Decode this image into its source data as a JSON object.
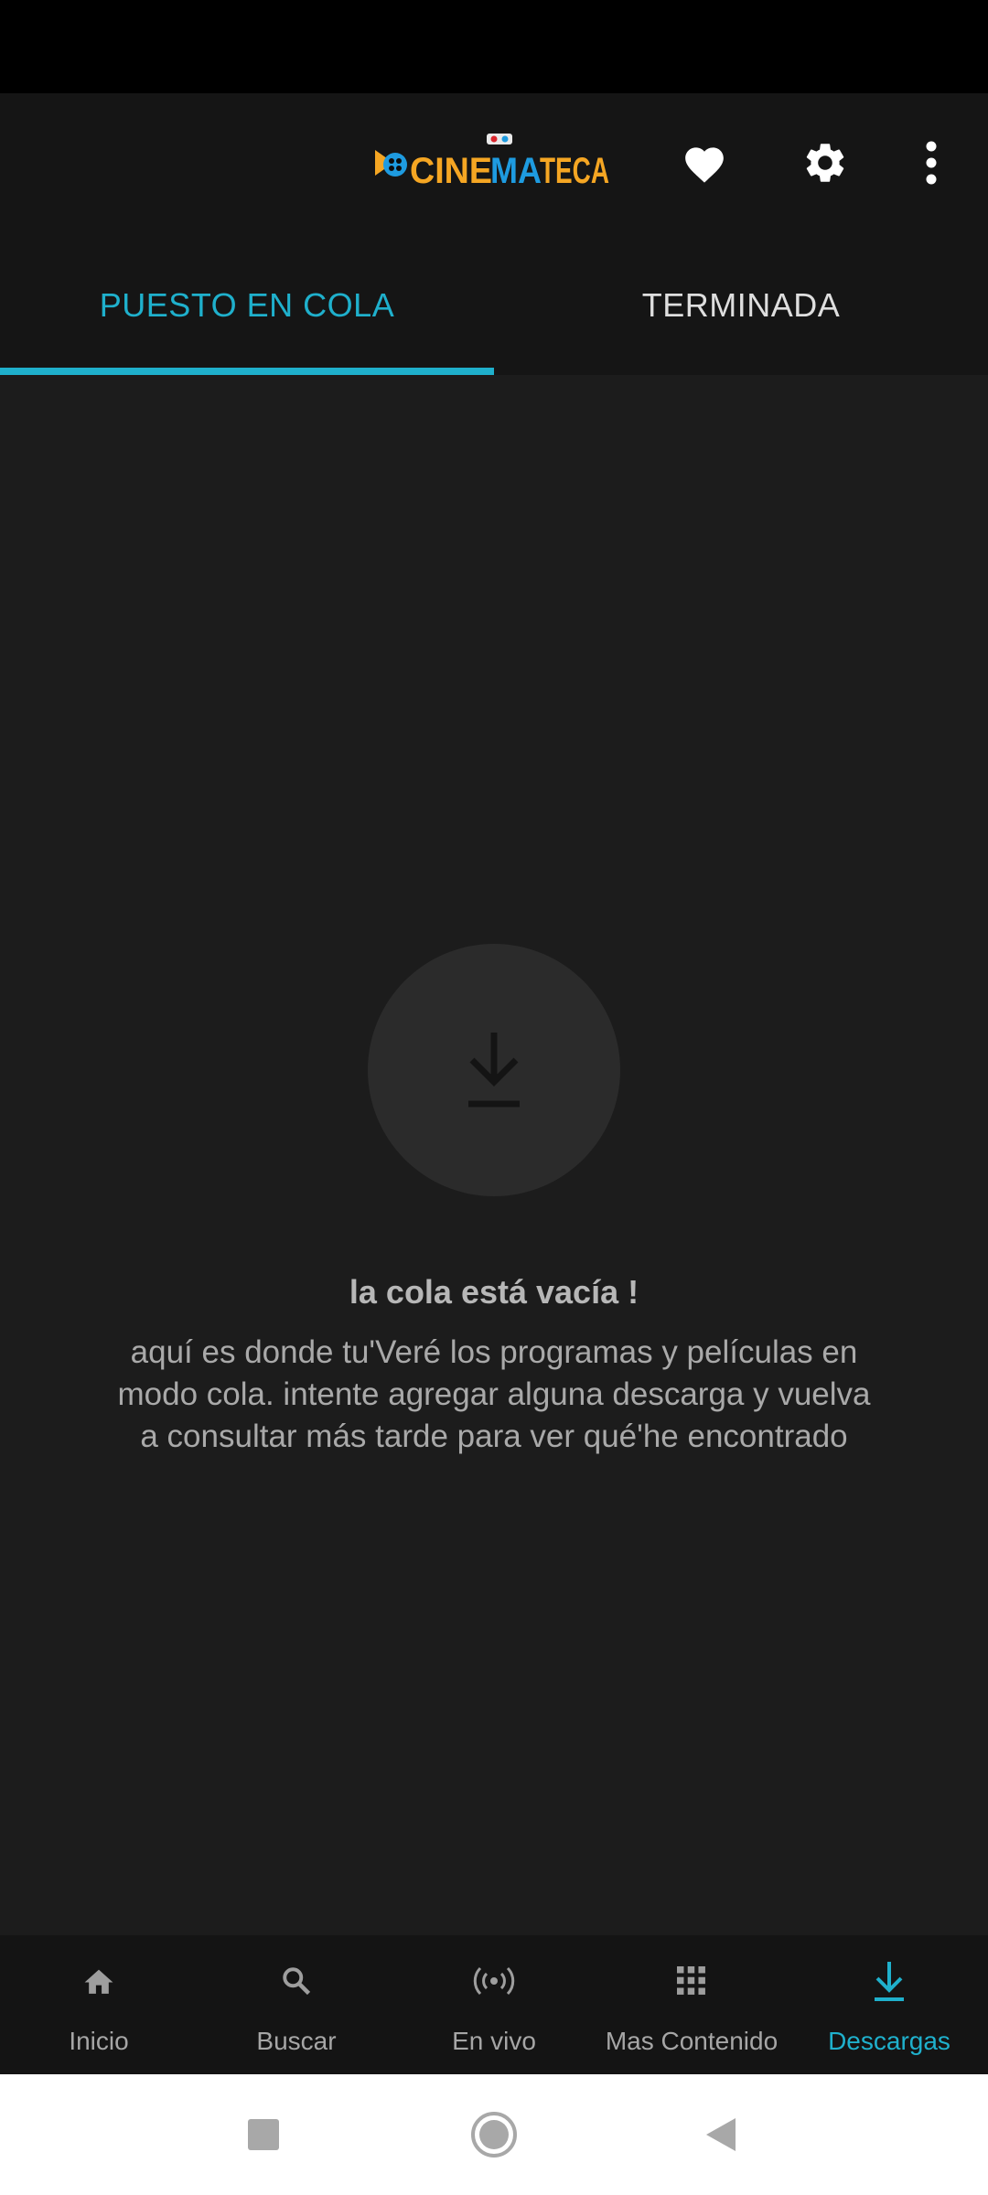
{
  "app": {
    "logo_text": "CINEMATECA",
    "brand_colors": {
      "orange": "#f5a623",
      "blue": "#1e9be0",
      "accent": "#1fb0cc"
    }
  },
  "header": {
    "icons": [
      "heart-icon",
      "gear-icon",
      "more-vert-icon"
    ]
  },
  "tabs": [
    {
      "label": "PUESTO EN COLA",
      "active": true
    },
    {
      "label": "TERMINADA",
      "active": false
    }
  ],
  "empty_state": {
    "icon": "download-icon",
    "title": "la cola está vacía !",
    "description": "aquí es donde tu'Veré los programas y películas en modo cola. intente agregar alguna descarga y vuelva a consultar más tarde para ver qué'he encontrado"
  },
  "bottom_nav": {
    "items": [
      {
        "label": "Inicio",
        "icon": "home-icon",
        "active": false
      },
      {
        "label": "Buscar",
        "icon": "search-icon",
        "active": false
      },
      {
        "label": "En vivo",
        "icon": "live-broadcast-icon",
        "active": false
      },
      {
        "label": "Mas Contenido",
        "icon": "apps-grid-icon",
        "active": false
      },
      {
        "label": "Descargas",
        "icon": "download-icon",
        "active": true
      }
    ]
  },
  "system_nav": {
    "buttons": [
      "recents-square-icon",
      "home-circle-icon",
      "back-triangle-icon"
    ]
  }
}
